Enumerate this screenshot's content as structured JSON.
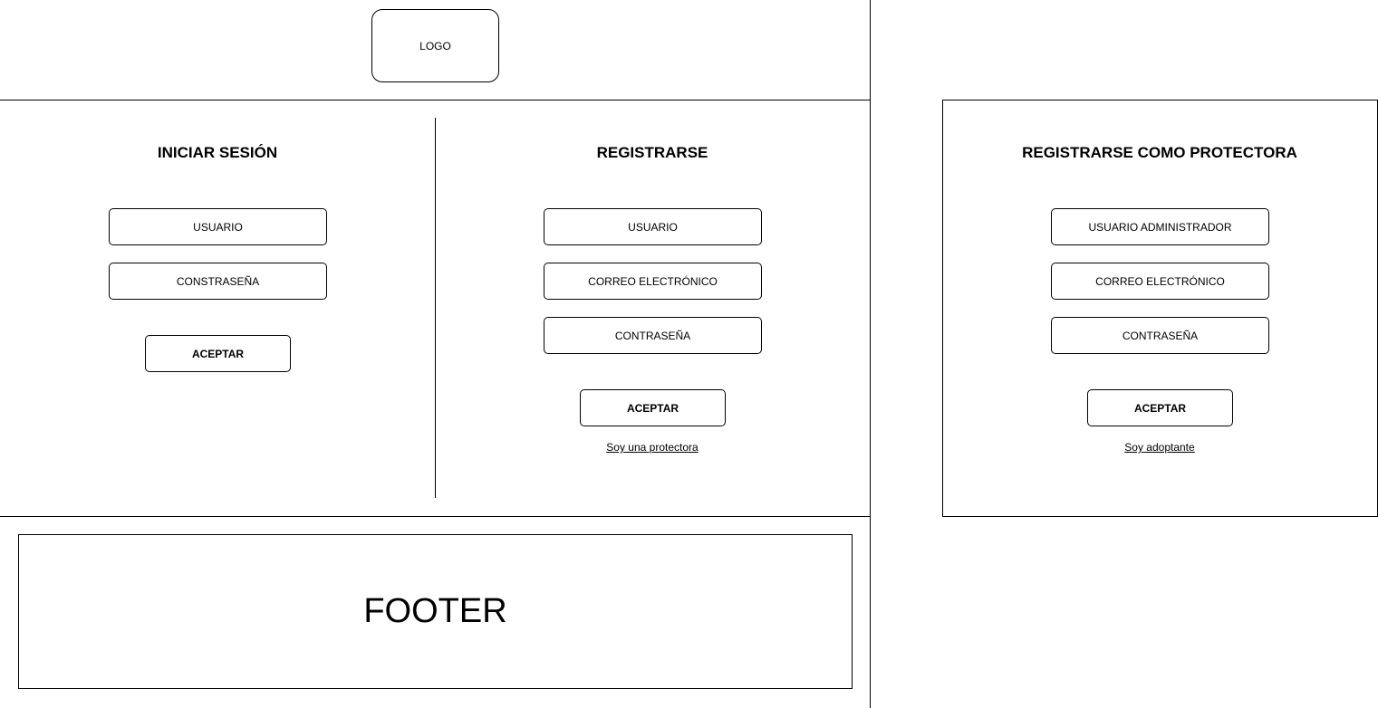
{
  "header": {
    "logo_label": "LOGO"
  },
  "login": {
    "title": "INICIAR SESIÓN",
    "user_field": "USUARIO",
    "password_field": "CONSTRASEÑA",
    "accept_button": "ACEPTAR"
  },
  "register": {
    "title": "REGISTRARSE",
    "user_field": "USUARIO",
    "email_field": "CORREO ELECTRÓNICO",
    "password_field": "CONTRASEÑA",
    "accept_button": "ACEPTAR",
    "alt_link": "Soy una protectora"
  },
  "register_protectora": {
    "title": "REGISTRARSE COMO PROTECTORA",
    "admin_user_field": "USUARIO ADMINISTRADOR",
    "email_field": "CORREO ELECTRÓNICO",
    "password_field": "CONTRASEÑA",
    "accept_button": "ACEPTAR",
    "alt_link": "Soy adoptante"
  },
  "footer": {
    "label": "FOOTER"
  }
}
